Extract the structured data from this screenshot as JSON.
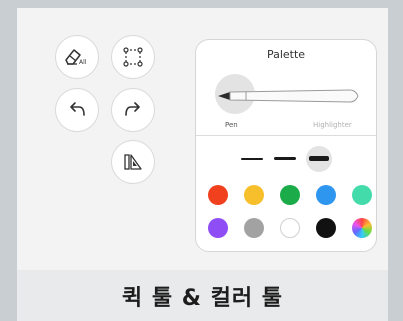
{
  "caption": "퀵 툴 & 컬러 툴",
  "tools": {
    "eraser_suffix": "All"
  },
  "palette": {
    "title": "Palette",
    "pen_label": "Pen",
    "highlighter_label": "Highlighter",
    "selected_tool": "pen",
    "thicknesses": [
      "thin",
      "medium",
      "thick"
    ],
    "selected_thickness": "thick",
    "colors_row1": [
      "#f0401d",
      "#f7bf2c",
      "#1bab48",
      "#2f96f0",
      "#44dbaa"
    ],
    "colors_row2": [
      "#8f4df5",
      "#a2a2a2",
      "#ffffff",
      "#111111",
      "rainbow"
    ]
  }
}
